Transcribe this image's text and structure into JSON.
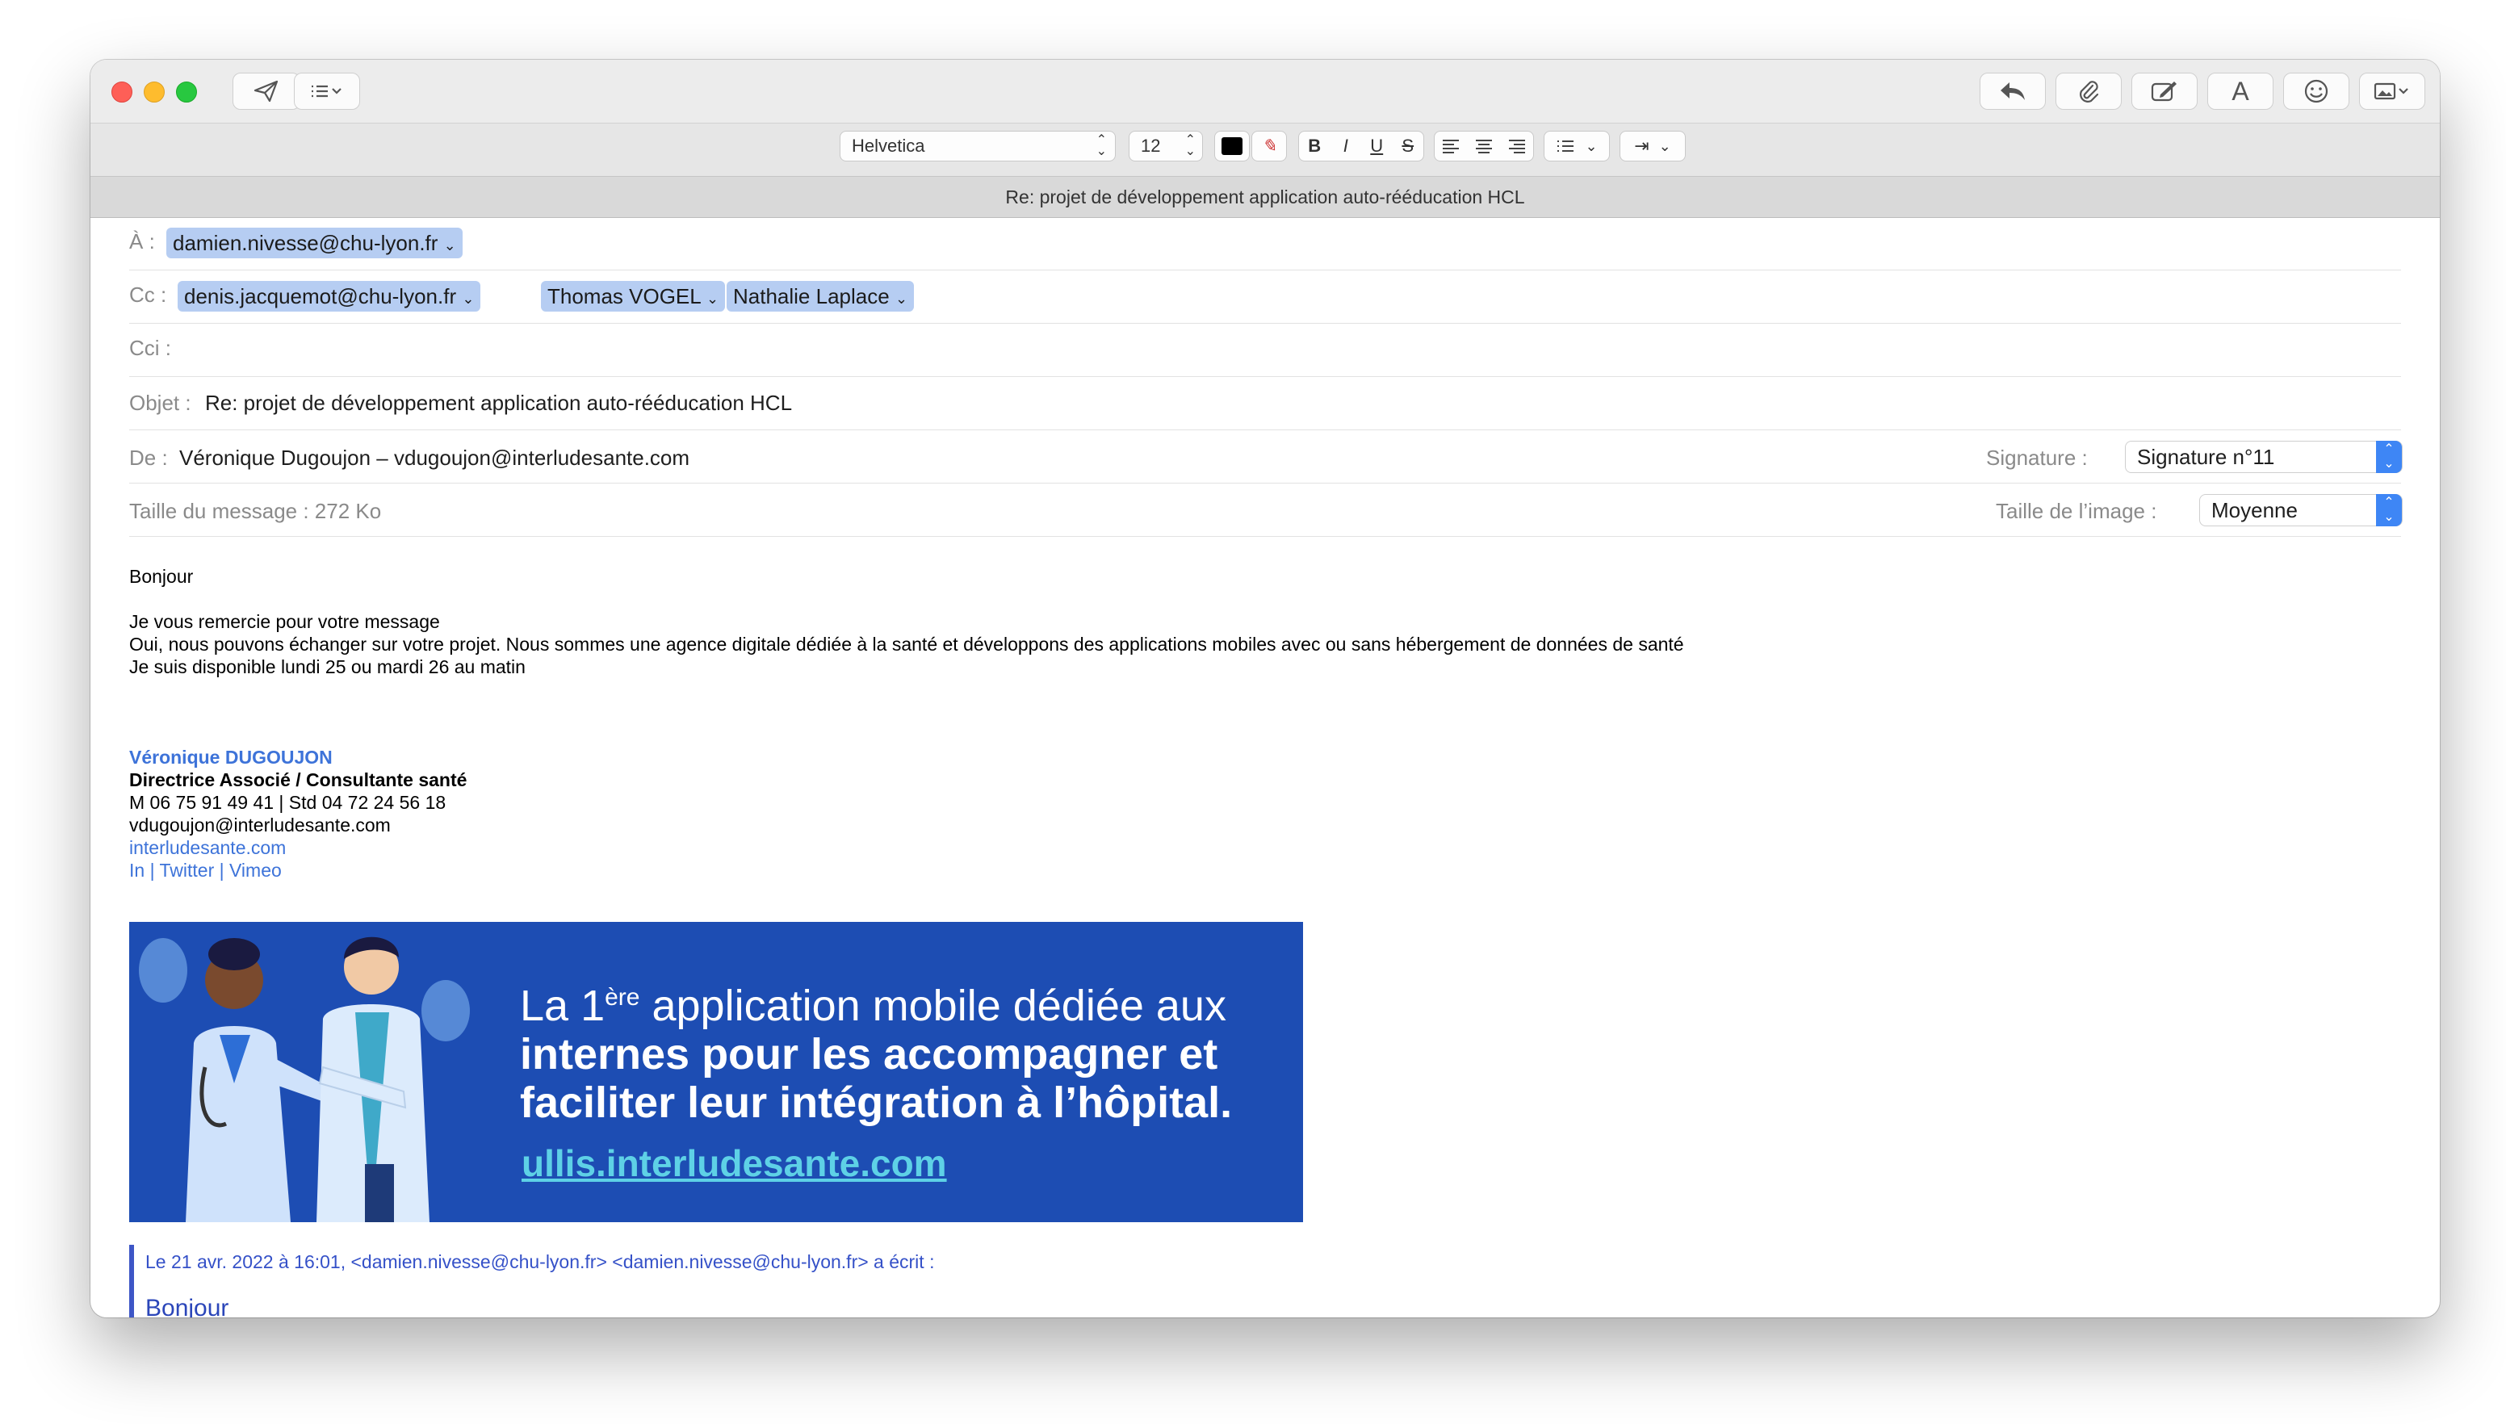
{
  "window": {
    "subject_bar": "Re: projet de développement application auto-rééducation HCL"
  },
  "format": {
    "font": "Helvetica",
    "size": "12",
    "bold": "B",
    "italic": "I",
    "underline": "U",
    "strike": "S"
  },
  "headers": {
    "to_label": "À :",
    "to": [
      "damien.nivesse@chu-lyon.fr"
    ],
    "cc_label": "Cc :",
    "cc": [
      "denis.jacquemot@chu-lyon.fr",
      "Thomas VOGEL",
      "Nathalie Laplace"
    ],
    "bcc_label": "Cci :",
    "subject_label": "Objet :",
    "subject": "Re: projet de développement application auto-rééducation HCL",
    "from_label": "De :",
    "from": "Véronique Dugoujon – vdugoujon@interludesante.com",
    "signature_label": "Signature :",
    "signature_value": "Signature n°11",
    "size_label": "Taille du message :",
    "size_value": "272 Ko",
    "image_size_label": "Taille de l’image :",
    "image_size_value": "Moyenne"
  },
  "message": {
    "greeting": "Bonjour",
    "lines": [
      "Je vous remercie pour votre message",
      "Oui, nous pouvons échanger sur votre projet. Nous sommes une agence digitale dédiée à la santé et développons des applications mobiles avec ou sans hébergement de données de santé",
      "Je suis disponible lundi 25 ou mardi 26 au matin"
    ]
  },
  "signature": {
    "name": "Véronique DUGOUJON",
    "title": "Directrice Associé / Consultante santé",
    "phones": "M 06 75 91 49 41 |  Std 04 72 24 56 18",
    "email": "vdugoujon@interludesante.com",
    "website": "interludesante.com",
    "social": "In | Twitter | Vimeo"
  },
  "banner": {
    "line1_prefix": "La 1",
    "line1_sup": "ère",
    "line1_suffix": " application mobile dédiée aux",
    "line2": "internes pour les accompagner et",
    "line3": "faciliter leur intégration à l’hôpital.",
    "url": "ullis.interludesante.com"
  },
  "quoted": {
    "header": "Le 21 avr. 2022 à 16:01, <damien.nivesse@chu-lyon.fr> <damien.nivesse@chu-lyon.fr> a écrit :",
    "first_line": "Bonjour"
  },
  "colors": {
    "banner_bg": "#1d4db3",
    "accent": "#3e86f5",
    "token_bg": "#b6cdf2",
    "link": "#3d73d9"
  }
}
